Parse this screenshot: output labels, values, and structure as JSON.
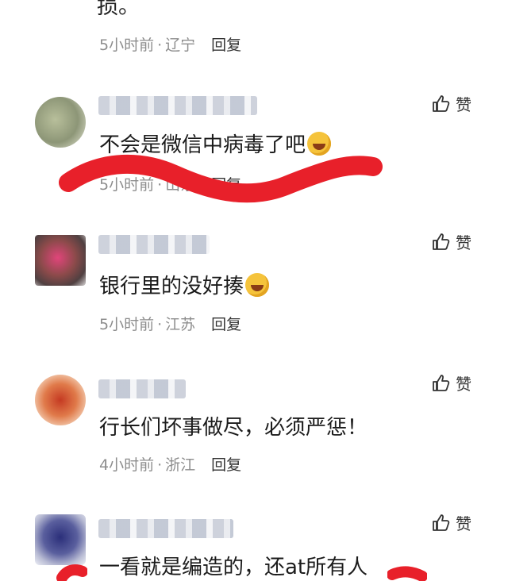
{
  "top_partial": {
    "text": "损。",
    "meta": {
      "time": "5小时前",
      "region": "辽宁",
      "reply": "回复"
    }
  },
  "comments": [
    {
      "text": "不会是微信中病毒了吧",
      "has_emoji": true,
      "time": "5小时前",
      "region": "山东",
      "reply": "回复",
      "like": "赞"
    },
    {
      "text": "银行里的没好揍",
      "has_emoji": true,
      "time": "5小时前",
      "region": "江苏",
      "reply": "回复",
      "like": "赞"
    },
    {
      "text": "行长们坏事做尽，必须严惩！",
      "has_emoji": false,
      "time": "4小时前",
      "region": "浙江",
      "reply": "回复",
      "like": "赞"
    },
    {
      "text": "一看就是编造的，还at所有人",
      "has_emoji": false,
      "like": "赞"
    }
  ],
  "colors": {
    "annotation_red": "#e8202a",
    "meta_gray": "#8d8d8d"
  },
  "icons": {
    "like": "thumbs-up-icon",
    "emoji": "laughing-crying-emoji-icon"
  }
}
